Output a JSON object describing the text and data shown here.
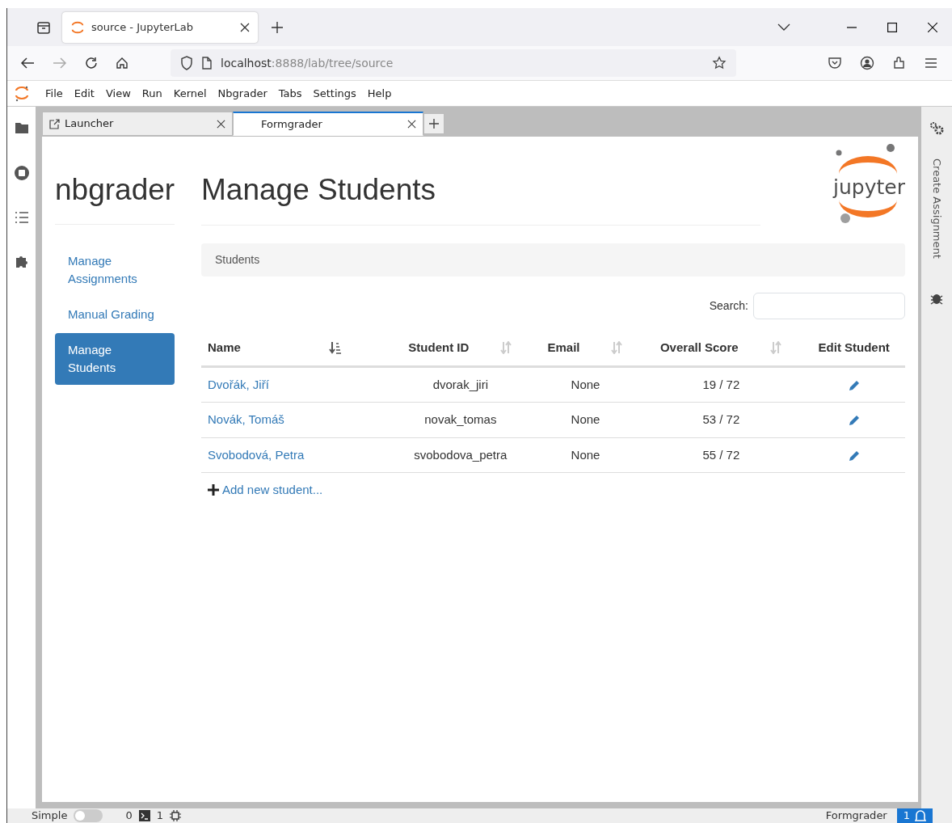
{
  "browser": {
    "tab_title": "source - JupyterLab",
    "url_host": "localhost",
    "url_rest": ":8888/lab/tree/source"
  },
  "menu": [
    "File",
    "Edit",
    "View",
    "Run",
    "Kernel",
    "Nbgrader",
    "Tabs",
    "Settings",
    "Help"
  ],
  "doc_tabs": [
    {
      "label": "Launcher",
      "selected": false,
      "kind": "launcher"
    },
    {
      "label": "Formgrader",
      "selected": true,
      "kind": "plain"
    }
  ],
  "nbgrader": {
    "brand": "nbgrader",
    "page_title": "Manage Students",
    "logo_text": "jupyter",
    "nav": [
      {
        "label": "Manage Assignments",
        "selected": false
      },
      {
        "label": "Manual Grading",
        "selected": false
      },
      {
        "label": "Manage Students",
        "selected": true
      }
    ],
    "panel_title": "Students",
    "search_label": "Search:",
    "columns": [
      {
        "label": "Name",
        "kind": "sorted"
      },
      {
        "label": "Student ID",
        "kind": "sortable"
      },
      {
        "label": "Email",
        "kind": "sortable"
      },
      {
        "label": "Overall Score",
        "kind": "sortable"
      },
      {
        "label": "Edit Student",
        "kind": "plain"
      }
    ],
    "rows": [
      {
        "name": "Dvořák, Jiří",
        "student_id": "dvorak_jiri",
        "email": "None",
        "score": "19 / 72"
      },
      {
        "name": "Novák, Tomáš",
        "student_id": "novak_tomas",
        "email": "None",
        "score": "53 / 72"
      },
      {
        "name": "Svobodová, Petra",
        "student_id": "svobodova_petra",
        "email": "None",
        "score": "55 / 72"
      }
    ],
    "add_link": "Add new student..."
  },
  "right_sidebar": {
    "label": "Create Assignment"
  },
  "status_bar": {
    "mode_label": "Simple",
    "simple_on": false,
    "terminals": "0",
    "kernels": "1",
    "activity": "Formgrader",
    "notifications": "1"
  }
}
